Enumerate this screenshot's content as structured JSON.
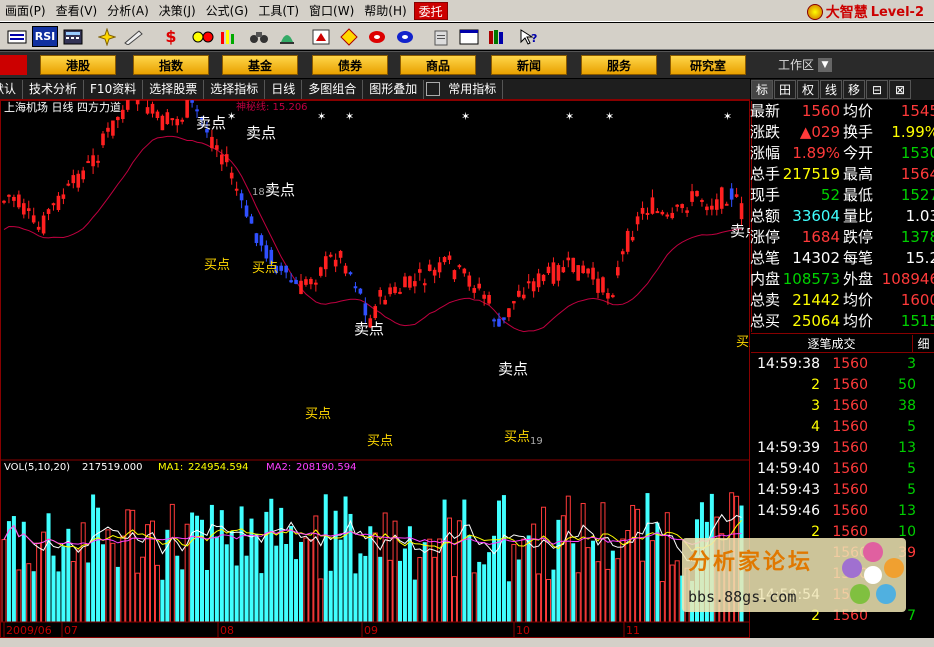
{
  "menu": [
    "画面(P)",
    "查看(V)",
    "分析(A)",
    "决策(J)",
    "公式(G)",
    "工具(T)",
    "窗口(W)",
    "帮助(H)"
  ],
  "entrust": "委托",
  "brand": {
    "name": "大智慧",
    "edition": "Level-2"
  },
  "toolbar": {
    "rsi": "RSI",
    "dollar": "$"
  },
  "nav_buttons": [
    "港股",
    "指数",
    "基金",
    "债券",
    "商品",
    "新闻",
    "服务",
    "研究室"
  ],
  "workarea": "工作区",
  "tabs": [
    "默认",
    "技术分析",
    "F10资料",
    "选择股票",
    "选择指标",
    "日线",
    "多图组合",
    "图形叠加",
    "常用指标"
  ],
  "right_tabs": [
    "标",
    "田",
    "权",
    "线",
    "移",
    "⊟",
    "⊠"
  ],
  "chart_data": {
    "type": "candlestick",
    "title": "上海机场 日线 四方力道",
    "indicator_label": "神秘线: 15.206",
    "x_tick_labels": [
      "2009/06",
      "07",
      "08",
      "09",
      "10",
      "11"
    ],
    "annotations": [
      "卖点",
      "卖点",
      "卖点",
      "卖点",
      "卖点",
      "卖点",
      "买点",
      "买点",
      "买点",
      "买点",
      "买点",
      "买点"
    ],
    "price_marks": [
      "18",
      "19"
    ],
    "volume": {
      "label": "VOL(5,10,20)",
      "vol": "217519.000",
      "ma1_label": "MA1:",
      "ma1": "224954.594",
      "ma2_label": "MA2:",
      "ma2": "208190.594"
    },
    "colors": {
      "up": "#ff3a3a",
      "down": "#40ffff",
      "ma1": "#ffff00",
      "ma2": "#ff40ff",
      "line": "#c00040"
    }
  },
  "quote": {
    "rows": [
      {
        "l": "最新",
        "v": "1560",
        "vc": "red",
        "l2": "均价",
        "v2": "1545",
        "v2c": "red"
      },
      {
        "l": "涨跌",
        "v": "▲029",
        "vc": "red",
        "l2": "换手",
        "v2": "1.99%",
        "v2c": "yel"
      },
      {
        "l": "涨幅",
        "v": "1.89%",
        "vc": "red",
        "l2": "今开",
        "v2": "1530",
        "v2c": "grn"
      },
      {
        "l": "总手",
        "v": "217519",
        "vc": "yel",
        "l2": "最高",
        "v2": "1564",
        "v2c": "red"
      },
      {
        "l": "现手",
        "v": "52",
        "vc": "grn",
        "l2": "最低",
        "v2": "1527",
        "v2c": "grn"
      },
      {
        "l": "总额",
        "v": "33604",
        "vc": "cyan",
        "l2": "量比",
        "v2": "1.03",
        "v2c": "wht"
      },
      {
        "l": "涨停",
        "v": "1684",
        "vc": "red",
        "l2": "跌停",
        "v2": "1378",
        "v2c": "grn"
      },
      {
        "l": "总笔",
        "v": "14302",
        "vc": "wht",
        "l2": "每笔",
        "v2": "15.2",
        "v2c": "wht"
      },
      {
        "l": "内盘",
        "v": "108573",
        "vc": "grn",
        "l2": "外盘",
        "v2": "108946",
        "v2c": "red"
      },
      {
        "l": "总卖",
        "v": "21442",
        "vc": "yel",
        "l2": "均价",
        "v2": "1600",
        "v2c": "red"
      },
      {
        "l": "总买",
        "v": "25064",
        "vc": "yel",
        "l2": "均价",
        "v2": "1515",
        "v2c": "grn"
      }
    ]
  },
  "ticks_header": {
    "title": "逐笔成交",
    "detail": "细"
  },
  "ticks": [
    {
      "t": "14:59:38",
      "p": "1560",
      "v": "3",
      "c": "grn"
    },
    {
      "t": "2",
      "p": "1560",
      "v": "50",
      "c": "grn"
    },
    {
      "t": "3",
      "p": "1560",
      "v": "38",
      "c": "grn"
    },
    {
      "t": "4",
      "p": "1560",
      "v": "5",
      "c": "grn"
    },
    {
      "t": "14:59:39",
      "p": "1560",
      "v": "13",
      "c": "grn"
    },
    {
      "t": "14:59:40",
      "p": "1560",
      "v": "5",
      "c": "grn"
    },
    {
      "t": "14:59:43",
      "p": "1560",
      "v": "5",
      "c": "grn"
    },
    {
      "t": "14:59:46",
      "p": "1560",
      "v": "13",
      "c": "grn"
    },
    {
      "t": "2",
      "p": "1560",
      "v": "10",
      "c": "grn"
    },
    {
      "t": "",
      "p": "1560",
      "v": "39",
      "c": "red"
    },
    {
      "t": "",
      "p": "1560",
      "v": "",
      "c": "red"
    },
    {
      "t": "14:59:54",
      "p": "1560",
      "v": "",
      "c": "red"
    },
    {
      "t": "2",
      "p": "1560",
      "v": "7",
      "c": "grn"
    }
  ],
  "watermark": {
    "title": "分析家论坛",
    "url": "bbs.88gs.com"
  }
}
